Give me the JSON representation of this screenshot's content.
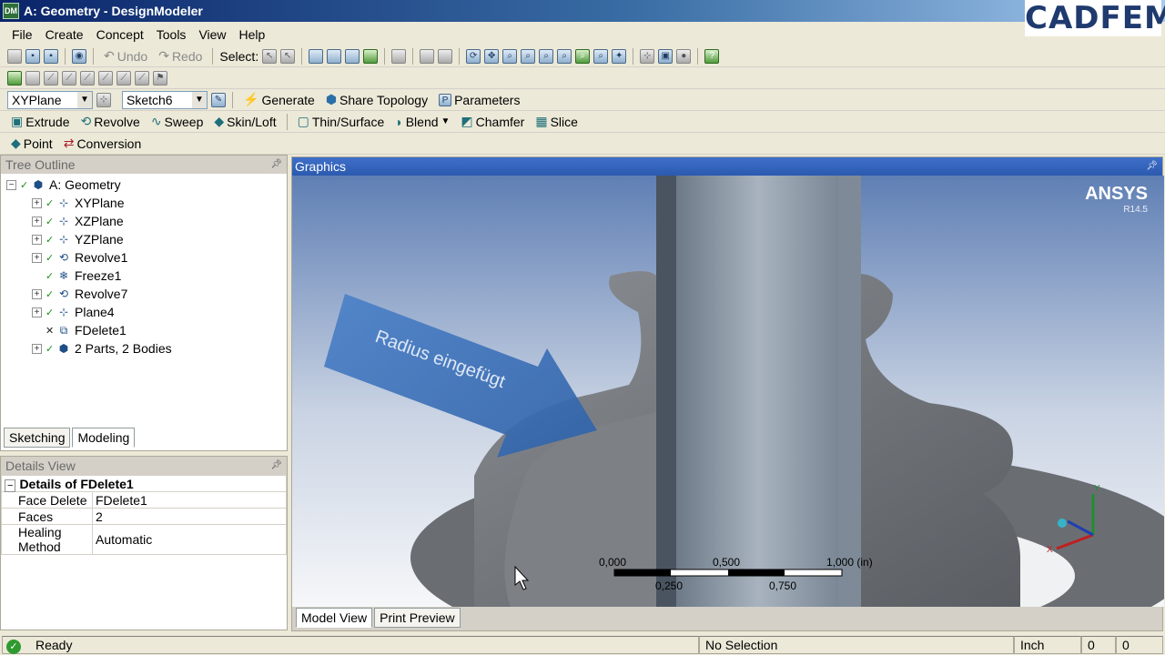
{
  "window": {
    "title": "A: Geometry - DesignModeler",
    "brand": "CADFEM",
    "app_badge": "DM"
  },
  "menu": [
    "File",
    "Create",
    "Concept",
    "Tools",
    "View",
    "Help"
  ],
  "toolbar1": {
    "undo": "Undo",
    "redo": "Redo",
    "select_label": "Select:"
  },
  "toolbar3": {
    "plane_value": "XYPlane",
    "sketch_value": "Sketch6",
    "generate": "Generate",
    "share_topology": "Share Topology",
    "parameters": "Parameters"
  },
  "toolbar4": [
    "Extrude",
    "Revolve",
    "Sweep",
    "Skin/Loft",
    "Thin/Surface",
    "Blend",
    "Chamfer",
    "Slice"
  ],
  "toolbar5": [
    "Point",
    "Conversion"
  ],
  "tree_outline": {
    "header": "Tree Outline",
    "root": "A: Geometry",
    "items": [
      {
        "label": "XYPlane",
        "expandable": true,
        "status": "check",
        "icon": "plane-icon"
      },
      {
        "label": "XZPlane",
        "expandable": true,
        "status": "check",
        "icon": "plane-icon"
      },
      {
        "label": "YZPlane",
        "expandable": true,
        "status": "check",
        "icon": "plane-icon"
      },
      {
        "label": "Revolve1",
        "expandable": true,
        "status": "check",
        "icon": "revolve-icon"
      },
      {
        "label": "Freeze1",
        "expandable": false,
        "status": "check",
        "icon": "freeze-icon"
      },
      {
        "label": "Revolve7",
        "expandable": true,
        "status": "check",
        "icon": "revolve-icon"
      },
      {
        "label": "Plane4",
        "expandable": true,
        "status": "check",
        "icon": "plane-icon"
      },
      {
        "label": "FDelete1",
        "expandable": false,
        "status": "x",
        "icon": "face-delete-icon"
      },
      {
        "label": "2 Parts, 2 Bodies",
        "expandable": true,
        "status": "check",
        "icon": "bodies-icon"
      }
    ]
  },
  "mode_tabs": [
    "Sketching",
    "Modeling"
  ],
  "details_view": {
    "header": "Details View",
    "title": "Details of FDelete1",
    "rows": [
      {
        "key": "Face Delete",
        "value": "FDelete1"
      },
      {
        "key": "Faces",
        "value": "2"
      },
      {
        "key": "Healing Method",
        "value": "Automatic"
      }
    ]
  },
  "graphics": {
    "header": "Graphics",
    "ansys_logo": "ANSYS",
    "ansys_version": "R14.5",
    "annotation": "Radius eingefügt",
    "scale_top": [
      "0,000",
      "0,500",
      "1,000 (in)"
    ],
    "scale_bottom": [
      "0,250",
      "0,750"
    ],
    "triad": [
      "Y",
      "X"
    ],
    "tabs": [
      "Model View",
      "Print Preview"
    ]
  },
  "statusbar": {
    "message": "Ready",
    "selection": "No Selection",
    "units": "Inch",
    "val1": "0",
    "val2": "0"
  }
}
